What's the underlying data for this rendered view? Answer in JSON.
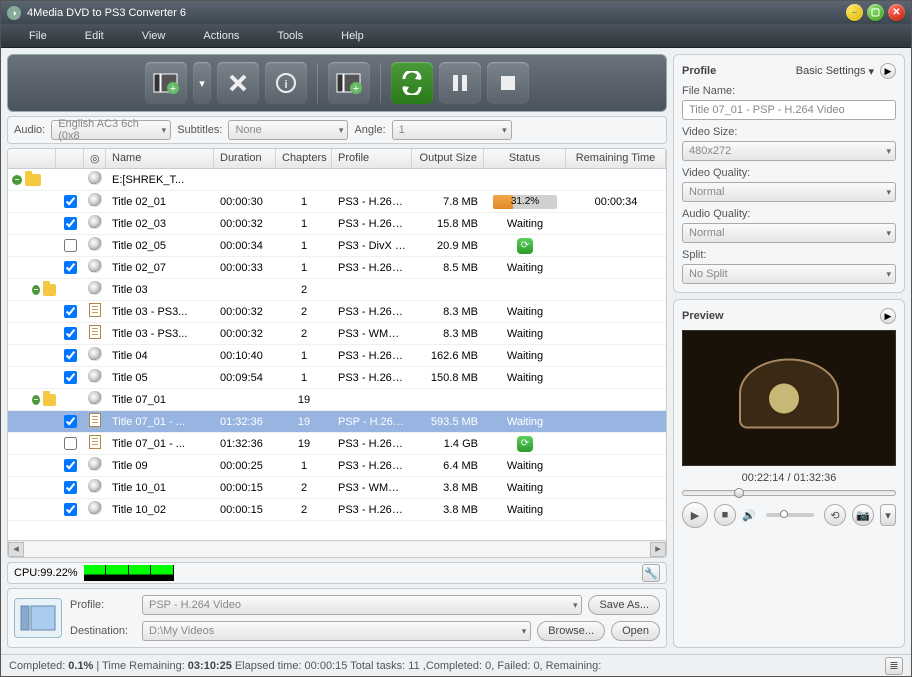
{
  "app": {
    "title": "4Media DVD to PS3 Converter 6"
  },
  "menu": [
    "File",
    "Edit",
    "View",
    "Actions",
    "Tools",
    "Help"
  ],
  "ddbar": {
    "audio_label": "Audio:",
    "audio_value": "English AC3 6ch (0x8",
    "sub_label": "Subtitles:",
    "sub_value": "None",
    "angle_label": "Angle:",
    "angle_value": "1"
  },
  "columns": {
    "name": "Name",
    "duration": "Duration",
    "chapters": "Chapters",
    "profile": "Profile",
    "output": "Output Size",
    "status": "Status",
    "remaining": "Remaining Time"
  },
  "rows": [
    {
      "tree": "root",
      "chk": null,
      "type": "folder",
      "name": "E:[SHREK_T...",
      "dur": "",
      "chap": "",
      "prof": "",
      "out": "",
      "stat": "",
      "rem": ""
    },
    {
      "tree": "c1",
      "chk": true,
      "type": "disc",
      "name": "Title 02_01",
      "dur": "00:00:30",
      "chap": "1",
      "prof": "PS3 - H.264 ...",
      "out": "7.8 MB",
      "stat": "progress",
      "progress": "31.2%",
      "rem": "00:00:34"
    },
    {
      "tree": "c1",
      "chk": true,
      "type": "disc",
      "name": "Title 02_03",
      "dur": "00:00:32",
      "chap": "1",
      "prof": "PS3 - H.264 ...",
      "out": "15.8 MB",
      "stat": "Waiting",
      "rem": ""
    },
    {
      "tree": "c1",
      "chk": false,
      "type": "disc",
      "name": "Title 02_05",
      "dur": "00:00:34",
      "chap": "1",
      "prof": "PS3 - DivX H...",
      "out": "20.9 MB",
      "stat": "icon",
      "rem": ""
    },
    {
      "tree": "c1",
      "chk": true,
      "type": "disc",
      "name": "Title 02_07",
      "dur": "00:00:33",
      "chap": "1",
      "prof": "PS3 - H.264 ...",
      "out": "8.5 MB",
      "stat": "Waiting",
      "rem": ""
    },
    {
      "tree": "group",
      "chk": null,
      "type": "disc",
      "name": "Title 03",
      "dur": "",
      "chap": "2",
      "prof": "",
      "out": "",
      "stat": "",
      "rem": ""
    },
    {
      "tree": "c2",
      "chk": true,
      "type": "doc",
      "name": "Title 03 - PS3...",
      "dur": "00:00:32",
      "chap": "2",
      "prof": "PS3 - H.264 ...",
      "out": "8.3 MB",
      "stat": "Waiting",
      "rem": ""
    },
    {
      "tree": "c2",
      "chk": true,
      "type": "doc",
      "name": "Title 03 - PS3...",
      "dur": "00:00:32",
      "chap": "2",
      "prof": "PS3 - WMV ...",
      "out": "8.3 MB",
      "stat": "Waiting",
      "rem": ""
    },
    {
      "tree": "c1",
      "chk": true,
      "type": "disc",
      "name": "Title 04",
      "dur": "00:10:40",
      "chap": "1",
      "prof": "PS3 - H.264 ...",
      "out": "162.6 MB",
      "stat": "Waiting",
      "rem": ""
    },
    {
      "tree": "c1",
      "chk": true,
      "type": "disc",
      "name": "Title 05",
      "dur": "00:09:54",
      "chap": "1",
      "prof": "PS3 - H.264 ...",
      "out": "150.8 MB",
      "stat": "Waiting",
      "rem": ""
    },
    {
      "tree": "group",
      "chk": null,
      "type": "disc",
      "name": "Title 07_01",
      "dur": "",
      "chap": "19",
      "prof": "",
      "out": "",
      "stat": "",
      "rem": ""
    },
    {
      "tree": "c2",
      "chk": true,
      "type": "doc",
      "name": "Title 07_01 - ...",
      "dur": "01:32:36",
      "chap": "19",
      "prof": "PSP - H.264 ...",
      "out": "593.5 MB",
      "stat": "Waiting",
      "rem": "",
      "sel": true
    },
    {
      "tree": "c2",
      "chk": false,
      "type": "doc",
      "name": "Title 07_01 - ...",
      "dur": "01:32:36",
      "chap": "19",
      "prof": "PS3 - H.264 ...",
      "out": "1.4 GB",
      "stat": "icon",
      "rem": ""
    },
    {
      "tree": "c1",
      "chk": true,
      "type": "disc",
      "name": "Title 09",
      "dur": "00:00:25",
      "chap": "1",
      "prof": "PS3 - H.264 ...",
      "out": "6.4 MB",
      "stat": "Waiting",
      "rem": ""
    },
    {
      "tree": "c1",
      "chk": true,
      "type": "disc",
      "name": "Title 10_01",
      "dur": "00:00:15",
      "chap": "2",
      "prof": "PS3 - WMV ...",
      "out": "3.8 MB",
      "stat": "Waiting",
      "rem": ""
    },
    {
      "tree": "c1",
      "chk": true,
      "type": "disc",
      "name": "Title 10_02",
      "dur": "00:00:15",
      "chap": "2",
      "prof": "PS3 - H.264 ...",
      "out": "3.8 MB",
      "stat": "Waiting",
      "rem": ""
    }
  ],
  "cpu": {
    "label": "CPU:99.22%"
  },
  "bottom": {
    "profile_label": "Profile:",
    "profile_value": "PSP - H.264 Video",
    "dest_label": "Destination:",
    "dest_value": "D:\\My Videos",
    "saveas": "Save As...",
    "browse": "Browse...",
    "open": "Open"
  },
  "status": {
    "text": "Completed: 0.1% | Time Remaining: 03:10:25 Elapsed time: 00:00:15 Total tasks: 11 ,Completed: 0, Failed: 0, Remaining:",
    "completed_label": "Completed:",
    "completed_val": "0.1%",
    "tr_label": " | Time Remaining: ",
    "tr_val": "03:10:25",
    "rest": " Elapsed time: 00:00:15 Total tasks: 11 ,Completed: 0, Failed: 0, Remaining:"
  },
  "profile_panel": {
    "title": "Profile",
    "link": "Basic Settings",
    "fn_label": "File Name:",
    "fn_value": "Title 07_01 - PSP - H.264 Video",
    "vs_label": "Video Size:",
    "vs_value": "480x272",
    "vq_label": "Video Quality:",
    "vq_value": "Normal",
    "aq_label": "Audio Quality:",
    "aq_value": "Normal",
    "sp_label": "Split:",
    "sp_value": "No Split"
  },
  "preview": {
    "title": "Preview",
    "time": "00:22:14 / 01:32:36"
  }
}
